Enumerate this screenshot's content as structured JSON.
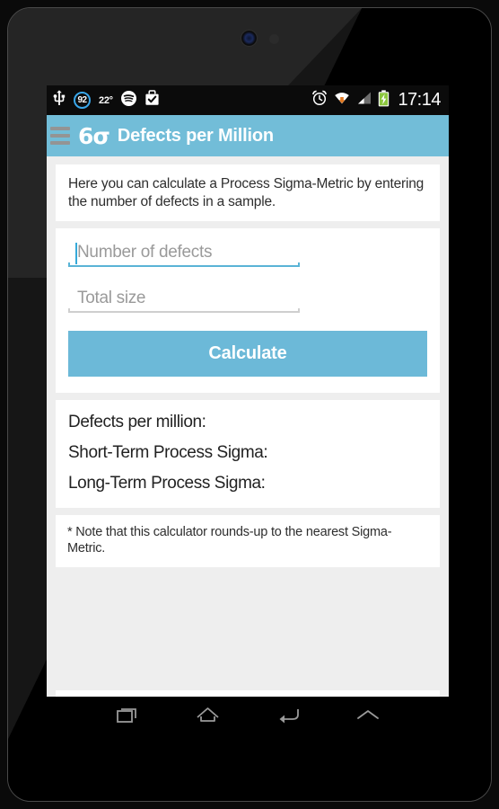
{
  "device": {
    "camera_icon": "camera-lens",
    "sensor_icon": "proximity-sensor"
  },
  "status_bar": {
    "usb_icon": "usb-icon",
    "battery_percent": "92",
    "temperature": "22°",
    "spotify_icon": "spotify-icon",
    "briefcase_icon": "briefcase-check-icon",
    "alarm_icon": "alarm-clock-icon",
    "wifi_icon": "wifi-download-icon",
    "signal_icon": "signal-bars-icon",
    "battery_icon": "battery-charging-icon",
    "clock": "17:14"
  },
  "app_bar": {
    "menu_icon": "hamburger-menu-icon",
    "logo": "6σ",
    "title": "Defects per Million",
    "color": "#72bdd8"
  },
  "intro": {
    "text": "Here you can calculate a Process Sigma-Metric by entering the number of defects in a sample."
  },
  "form": {
    "defects_placeholder": "Number of defects",
    "defects_value": "",
    "total_placeholder": "Total size",
    "total_value": "",
    "calculate_label": "Calculate",
    "button_color": "#6cb9d8",
    "focus_color": "#5ab4d6"
  },
  "results": {
    "rows": [
      {
        "label": "Defects per million:",
        "value": ""
      },
      {
        "label": "Short-Term Process Sigma:",
        "value": ""
      },
      {
        "label": "Long-Term Process Sigma:",
        "value": ""
      }
    ]
  },
  "note": {
    "text": "* Note that this calculator rounds-up to the nearest Sigma-Metric."
  },
  "nav_bar": {
    "recents_icon": "recent-apps-icon",
    "home_icon": "home-icon",
    "back_icon": "back-arrow-icon",
    "expand_icon": "chevron-up-icon"
  }
}
